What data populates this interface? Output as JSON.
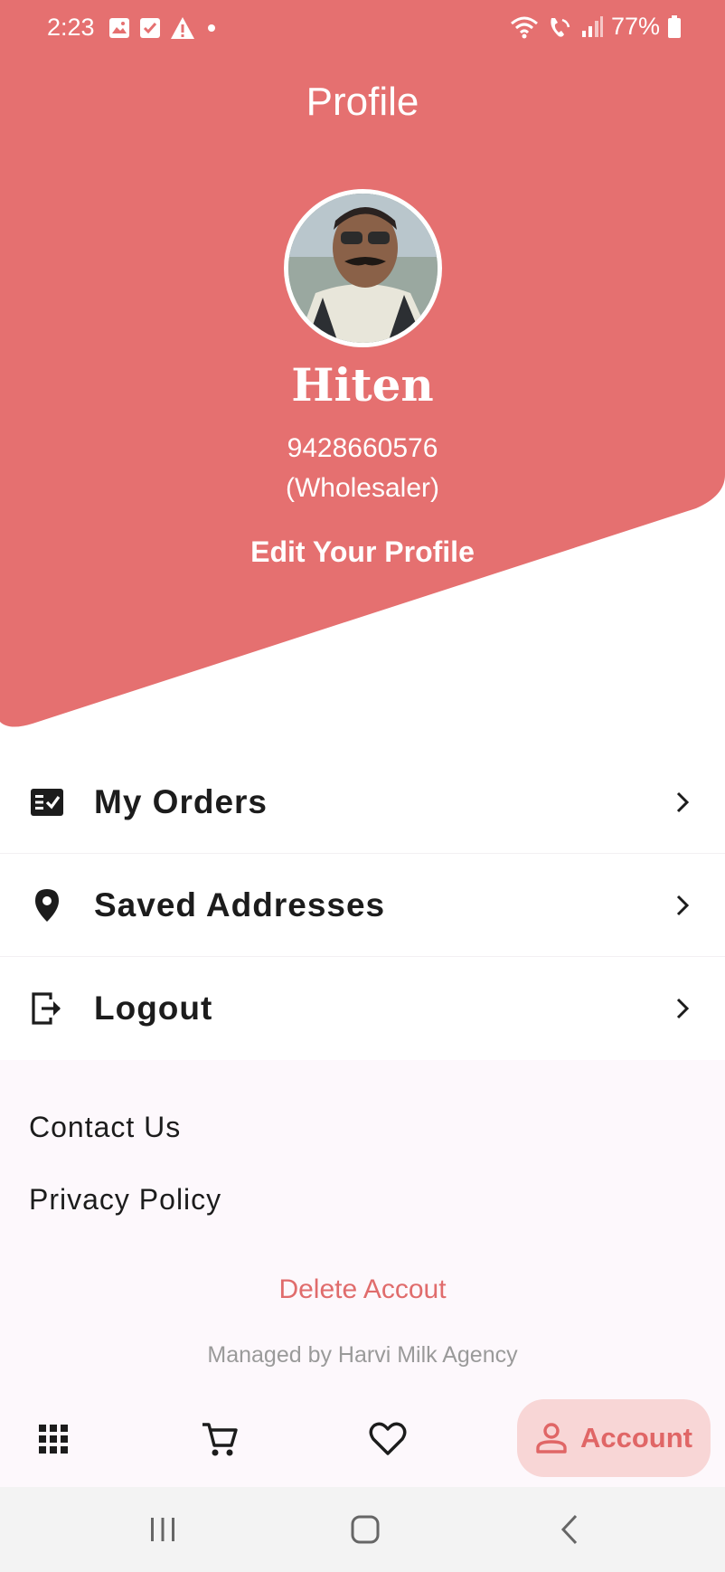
{
  "colors": {
    "accent": "#e57070",
    "accent_soft": "#f8d6d6",
    "delete_text": "#e06c6c",
    "background": "#ffffff",
    "section_background": "#fdf8fc"
  },
  "status_bar": {
    "time": "2:23",
    "battery": "77%",
    "icons_left": [
      "image-icon",
      "check-box-icon",
      "warning-icon",
      "dot-icon"
    ],
    "icons_right": [
      "wifi-icon",
      "wifi-calling-icon",
      "signal-icon",
      "battery-icon"
    ]
  },
  "header": {
    "title": "Profile"
  },
  "profile": {
    "name": "Hiten",
    "phone": "9428660576",
    "role": "(Wholesaler)",
    "edit_label": "Edit Your Profile"
  },
  "menu": {
    "items": [
      {
        "label": "My Orders",
        "icon": "orders-icon"
      },
      {
        "label": "Saved Addresses",
        "icon": "location-pin-icon"
      },
      {
        "label": "Logout",
        "icon": "logout-icon"
      }
    ]
  },
  "links": {
    "contact": "Contact Us",
    "privacy": "Privacy Policy",
    "delete": "Delete Accout",
    "managed_by": "Managed by Harvi Milk Agency"
  },
  "bottom_nav": {
    "items": [
      {
        "icon": "grid-icon",
        "active": false
      },
      {
        "icon": "cart-icon",
        "active": false
      },
      {
        "icon": "heart-icon",
        "active": false
      },
      {
        "icon": "person-icon",
        "label": "Account",
        "active": true
      }
    ]
  }
}
